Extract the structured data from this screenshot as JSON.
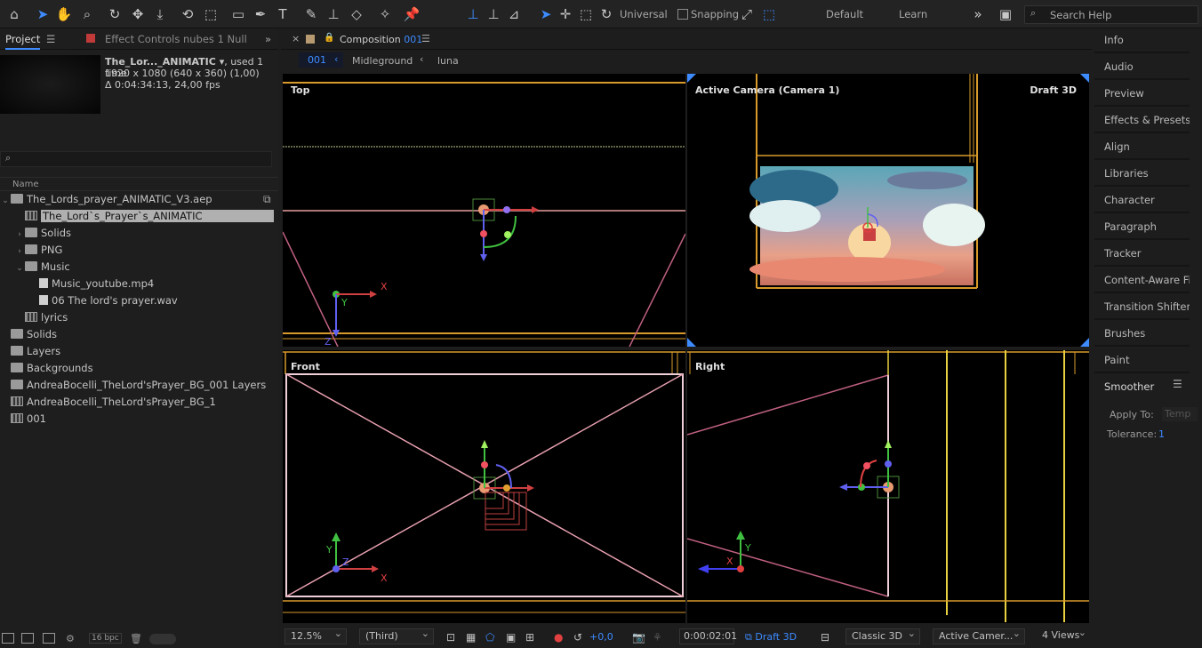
{
  "toolbar": {
    "axis_mode": "Universal",
    "snapping": "Snapping",
    "workspaces": [
      "Default",
      "Learn"
    ],
    "search_placeholder": "Search Help"
  },
  "project_panel": {
    "tab_project": "Project",
    "tab_effect_controls": "Effect Controls nubes 1 Null",
    "selected_name": "The_Lor..._ANIMATIC",
    "selected_used": ", used 1 time",
    "selected_res": "1920 x 1080  (640 x 360) (1,00)",
    "selected_dur": "Δ 0:04:34:13, 24,00 fps",
    "column_name": "Name",
    "items": [
      {
        "label": "The_Lords_prayer_ANIMATIC_V3.aep",
        "type": "folder",
        "indent": 0,
        "caret": "⌄"
      },
      {
        "label": "The_Lord`s_Prayer`s_ANIMATIC",
        "type": "comp",
        "indent": 1,
        "caret": "",
        "selected": true
      },
      {
        "label": "Solids",
        "type": "folder",
        "indent": 1,
        "caret": "›"
      },
      {
        "label": "PNG",
        "type": "folder",
        "indent": 1,
        "caret": "›"
      },
      {
        "label": "Music",
        "type": "folder",
        "indent": 1,
        "caret": "⌄"
      },
      {
        "label": "Music_youtube.mp4",
        "type": "file",
        "indent": 2,
        "caret": ""
      },
      {
        "label": "06 The lord's prayer.wav",
        "type": "file",
        "indent": 2,
        "caret": ""
      },
      {
        "label": "lyrics",
        "type": "comp",
        "indent": 1,
        "caret": ""
      },
      {
        "label": "Solids",
        "type": "folder",
        "indent": 0,
        "caret": ""
      },
      {
        "label": "Layers",
        "type": "folder",
        "indent": 0,
        "caret": ""
      },
      {
        "label": "Backgrounds",
        "type": "folder",
        "indent": 0,
        "caret": ""
      },
      {
        "label": "AndreaBocelli_TheLord'sPrayer_BG_001 Layers",
        "type": "folder",
        "indent": 0,
        "caret": ""
      },
      {
        "label": "AndreaBocelli_TheLord'sPrayer_BG_1",
        "type": "comp",
        "indent": 0,
        "caret": ""
      },
      {
        "label": "001",
        "type": "comp",
        "indent": 0,
        "caret": ""
      }
    ],
    "bpc": "16 bpc"
  },
  "composition": {
    "tab_prefix": "Composition",
    "tab_name": "001",
    "breadcrumbs": [
      "001",
      "Midleground",
      "luna"
    ],
    "views": {
      "top": "Top",
      "active": "Active Camera (Camera 1)",
      "renderer": "Draft 3D",
      "front": "Front",
      "right": "Right"
    },
    "axes": {
      "x": "X",
      "y": "Y",
      "z": "Z"
    },
    "viewer": {
      "zoom": "12.5%",
      "resolution": "(Third)",
      "exposure": "+0,0",
      "timecode": "0:00:02:01",
      "draft3d": "Draft 3D",
      "renderer": "Classic 3D",
      "camera": "Active Camer...",
      "layout": "4 Views"
    }
  },
  "right_panel": {
    "items": [
      "Info",
      "Audio",
      "Preview",
      "Effects & Presets",
      "Align",
      "Libraries",
      "Character",
      "Paragraph",
      "Tracker",
      "Content-Aware Fil",
      "Transition Shifter",
      "Brushes",
      "Paint",
      "Smoother"
    ],
    "apply_to_label": "Apply To:",
    "apply_to_value": "Temp",
    "tolerance_label": "Tolerance:",
    "tolerance_value": "1"
  },
  "colors": {
    "accent": "#3d8bff",
    "guide_orange": "#d89a2a",
    "guide_yellow": "#e8d040",
    "wire_pink": "#e8a0b0"
  }
}
